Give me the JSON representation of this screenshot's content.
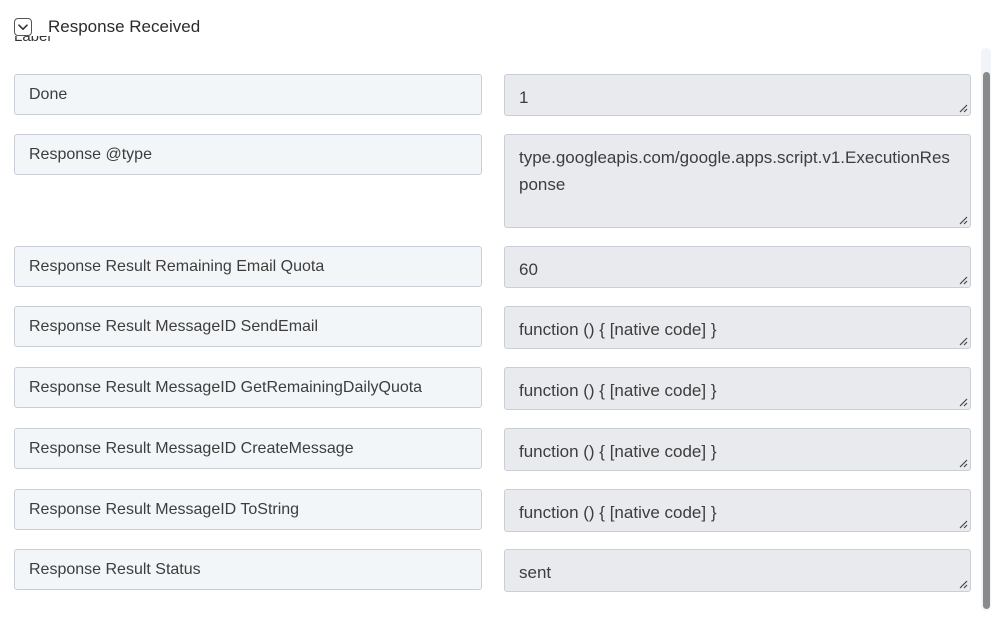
{
  "header": {
    "title": "Response Received",
    "toggle_icon": "chevron-down-icon",
    "clipped_label": "Label"
  },
  "fields": [
    {
      "key": "Done",
      "value": "1"
    },
    {
      "key": "Response @type",
      "value": "type.googleapis.com/google.apps.script.v1.ExecutionResponse"
    },
    {
      "key": "Response Result Remaining Email Quota",
      "value": "60"
    },
    {
      "key": "Response Result MessageID SendEmail",
      "value": "function () { [native code] }"
    },
    {
      "key": "Response Result MessageID GetRemainingDailyQuota",
      "value": "function () { [native code] }"
    },
    {
      "key": "Response Result MessageID CreateMessage",
      "value": "function () { [native code] }"
    },
    {
      "key": "Response Result MessageID ToString",
      "value": "function () { [native code] }"
    },
    {
      "key": "Response Result Status",
      "value": "sent"
    }
  ]
}
